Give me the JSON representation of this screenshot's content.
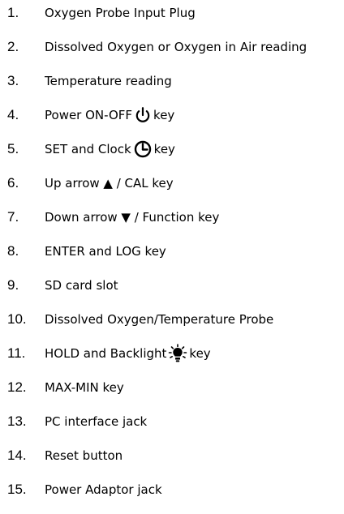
{
  "items": [
    {
      "number": "1.",
      "text": "Oxygen Probe Input Plug"
    },
    {
      "number": "2.",
      "text": "Dissolved Oxygen or Oxygen in Air reading"
    },
    {
      "number": "3.",
      "text": "Temperature reading"
    },
    {
      "number": "4.",
      "text_before": "Power ON-OFF",
      "text_after": "key",
      "icon": "power-icon"
    },
    {
      "number": "5.",
      "text_before": "SET and Clock",
      "text_after": "key",
      "icon": "clock-icon"
    },
    {
      "number": "6.",
      "text": "Up arrow ▲ / CAL key"
    },
    {
      "number": "7.",
      "text": "Down arrow ▼ / Function key"
    },
    {
      "number": "8.",
      "text": "ENTER and LOG key"
    },
    {
      "number": "9.",
      "text": "SD card slot"
    },
    {
      "number": "10.",
      "text": "Dissolved Oxygen/Temperature Probe"
    },
    {
      "number": "11.",
      "text_before": "HOLD and Backlight",
      "text_after": "key",
      "icon": "backlight-bulb-icon"
    },
    {
      "number": "12.",
      "text": "MAX-MIN key"
    },
    {
      "number": "13.",
      "text": "PC interface jack"
    },
    {
      "number": "14.",
      "text": "Reset button"
    },
    {
      "number": "15.",
      "text": "Power Adaptor jack"
    }
  ]
}
